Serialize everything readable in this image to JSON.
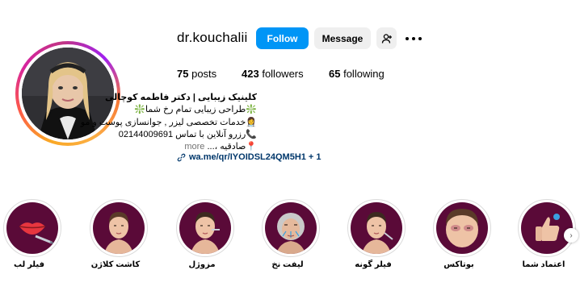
{
  "profile": {
    "username": "dr.kouchalii",
    "follow_label": "Follow",
    "message_label": "Message",
    "stats": {
      "posts_count": "75",
      "posts_label": "posts",
      "followers_count": "423",
      "followers_label": "followers",
      "following_count": "65",
      "following_label": "following"
    },
    "bio": {
      "name": "کلینیک زیبایی | دکتر فاطمه کوچالی",
      "line1": "❇️طراحی زیبایی تمام رخ شما❇️",
      "line2": "👩‍⚕️خدمات تخصصی لیزر , جوانسازی پوست و مو",
      "line3": "📞رزرو آنلاین با تماس 02144009691",
      "line4": "📍صادقیه ،...",
      "more_label": "more",
      "link": "wa.me/qr/IYOIDSL24QM5H1 + 1"
    }
  },
  "highlights": [
    {
      "label": "فیلر لب",
      "icon": "lips-icon"
    },
    {
      "label": "کاشت کلاژن",
      "icon": "face-icon"
    },
    {
      "label": "مزوژل",
      "icon": "face-icon"
    },
    {
      "label": "لیفت نخ",
      "icon": "elderly-face-icon"
    },
    {
      "label": "فیلر گونه",
      "icon": "face-icon"
    },
    {
      "label": "بوتاکس",
      "icon": "face-icon"
    },
    {
      "label": "اعتماد شما",
      "icon": "thumbs-up-icon"
    }
  ],
  "colors": {
    "follow_button": "#0095f6",
    "secondary_button": "#efefef",
    "highlight_bg": "#5a0a38",
    "link": "#00376b"
  }
}
